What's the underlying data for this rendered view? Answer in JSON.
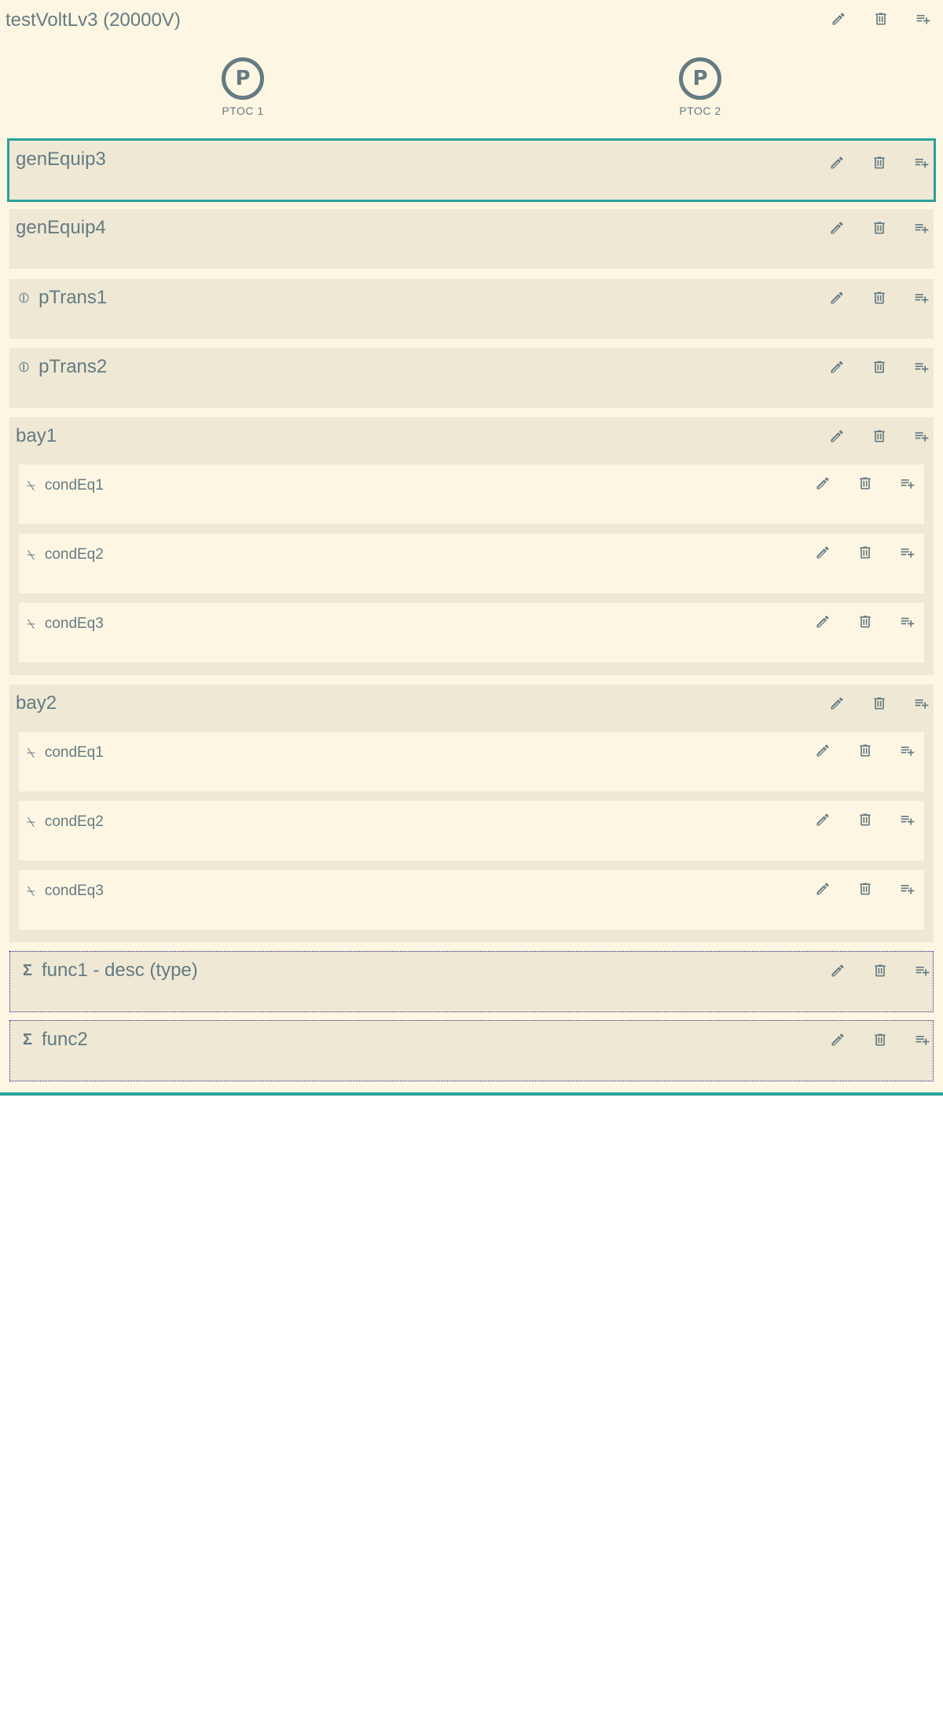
{
  "voltage_level": {
    "title": "testVoltLv3 (20000V)",
    "lnodes": [
      {
        "symbol": "P",
        "label": "PTOC 1"
      },
      {
        "symbol": "P",
        "label": "PTOC 2"
      }
    ],
    "items": {
      "gen3": {
        "title": "genEquip3"
      },
      "gen4": {
        "title": "genEquip4"
      },
      "pt1": {
        "title": "pTrans1",
        "icon": "ptrans-icon"
      },
      "pt2": {
        "title": "pTrans2",
        "icon": "ptrans-icon"
      },
      "bay1": {
        "title": "bay1",
        "equipment": [
          {
            "title": "condEq1",
            "icon": "switch-icon"
          },
          {
            "title": "condEq2",
            "icon": "switch-icon"
          },
          {
            "title": "condEq3",
            "icon": "switch-icon"
          }
        ]
      },
      "bay2": {
        "title": "bay2",
        "equipment": [
          {
            "title": "condEq1",
            "icon": "switch-icon"
          },
          {
            "title": "condEq2",
            "icon": "switch-icon"
          },
          {
            "title": "condEq3",
            "icon": "switch-icon"
          }
        ]
      },
      "func1": {
        "title": "func1 - desc (type)",
        "icon": "sigma-icon"
      },
      "func2": {
        "title": "func2",
        "icon": "sigma-icon"
      }
    }
  },
  "icons": {
    "edit": "pencil-icon",
    "delete": "trash-icon",
    "add": "playlist-add-icon",
    "ptrans_glyph": "⦶",
    "switch_glyph": "⍀",
    "sigma_glyph": "Σ"
  },
  "colors": {
    "background": "#fdf6e3",
    "card": "#eee8d5",
    "text": "#657b83",
    "selected_border": "#2aa198",
    "function_border": "#1a237e"
  }
}
